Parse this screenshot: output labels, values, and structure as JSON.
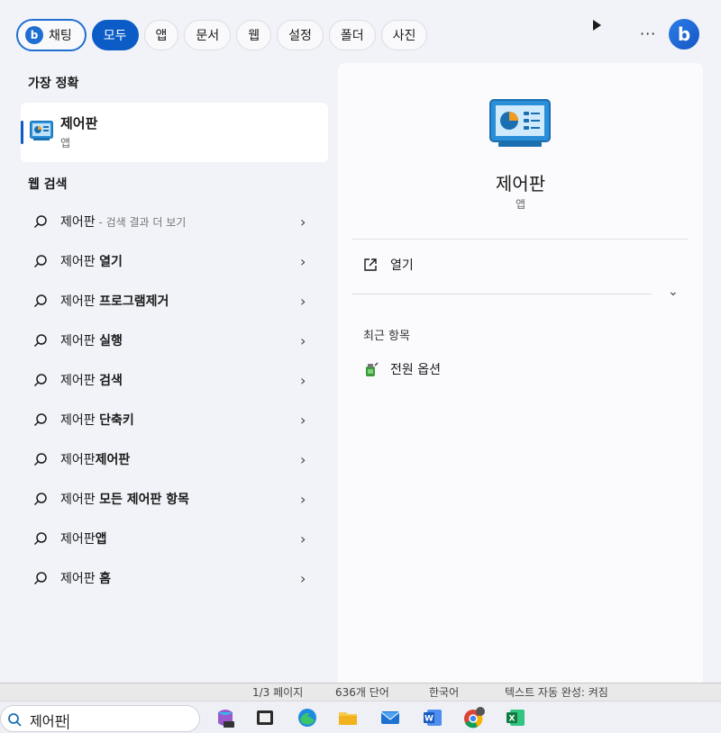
{
  "filters": {
    "chat": "채팅",
    "items": [
      "모두",
      "앱",
      "문서",
      "웹",
      "설정",
      "폴더",
      "사진"
    ],
    "active_index": 0,
    "more": "···"
  },
  "best_match": {
    "heading": "가장 정확",
    "title": "제어판",
    "subtitle": "앱"
  },
  "web_search": {
    "heading": "웹 검색",
    "items": [
      {
        "prefix": "제어판",
        "bold": "",
        "sub": " - 검색 결과 더 보기"
      },
      {
        "prefix": "제어판 ",
        "bold": "열기",
        "sub": ""
      },
      {
        "prefix": "제어판 ",
        "bold": "프로그램제거",
        "sub": ""
      },
      {
        "prefix": "제어판 ",
        "bold": "실행",
        "sub": ""
      },
      {
        "prefix": "제어판 ",
        "bold": "검색",
        "sub": ""
      },
      {
        "prefix": "제어판 ",
        "bold": "단축키",
        "sub": ""
      },
      {
        "prefix": "제어판",
        "bold": "제어판",
        "sub": ""
      },
      {
        "prefix": "제어판 ",
        "bold": "모든 제어판 항목",
        "sub": ""
      },
      {
        "prefix": "제어판",
        "bold": "앱",
        "sub": ""
      },
      {
        "prefix": "제어판 ",
        "bold": "홈",
        "sub": ""
      }
    ]
  },
  "detail": {
    "title": "제어판",
    "subtitle": "앱",
    "open_label": "열기",
    "recent_heading": "최근 항목",
    "recent_items": [
      "전원 옵션"
    ]
  },
  "word_status": {
    "page": "1/3 페이지",
    "words": "636개 단어",
    "lang": "한국어",
    "text_pred": "텍스트 자동 완성: 켜짐"
  },
  "taskbar": {
    "search_value": "제어판"
  },
  "colors": {
    "accent": "#0b5cc6",
    "panel_bg": "#f1f3f8"
  }
}
